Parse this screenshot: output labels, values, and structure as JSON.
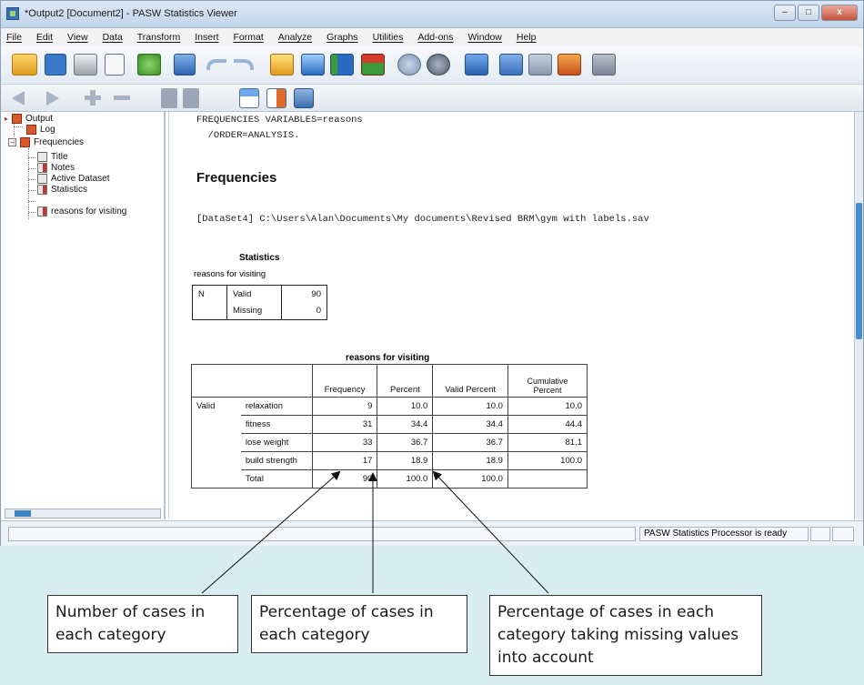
{
  "window": {
    "title": "*Output2 [Document2] - PASW Statistics Viewer",
    "controls": {
      "minimize": "–",
      "maximize": "□",
      "close": "x"
    }
  },
  "menu": {
    "items": [
      "File",
      "Edit",
      "View",
      "Data",
      "Transform",
      "Insert",
      "Format",
      "Analyze",
      "Graphs",
      "Utilities",
      "Add-ons",
      "Window",
      "Help"
    ]
  },
  "toolbar": {
    "row1_icons": [
      "open-folder-icon",
      "save-icon",
      "print-icon",
      "print-preview-icon",
      "export-icon",
      "recall-dialog-icon",
      "undo-icon",
      "redo-icon",
      "goto-case-icon",
      "goto-variable-icon",
      "variables-icon",
      "insert-cases-icon",
      "split-file-icon",
      "weight-cases-icon",
      "select-cases-icon",
      "value-labels-icon",
      "use-sets-icon",
      "show-all-icon",
      "spelling-icon"
    ],
    "row2_icons": [
      "back-icon",
      "forward-icon",
      "expand-icon",
      "collapse-icon",
      "show-icon",
      "hide-icon",
      "insert-heading-icon",
      "insert-title-icon",
      "insert-text-icon"
    ]
  },
  "outline": {
    "items": [
      {
        "label": "Output",
        "level": 0
      },
      {
        "label": "Log",
        "level": 1
      },
      {
        "label": "Frequencies",
        "level": 1
      },
      {
        "label": "Title",
        "level": 2
      },
      {
        "label": "Notes",
        "level": 2
      },
      {
        "label": "Active Dataset",
        "level": 2
      },
      {
        "label": "Statistics",
        "level": 2
      },
      {
        "label": "reasons for visiting",
        "level": 2
      }
    ]
  },
  "output": {
    "syntax_line1": "FREQUENCIES VARIABLES=reasons",
    "syntax_line2": "  /ORDER=ANALYSIS.",
    "heading": "Frequencies",
    "dataset_line": "[DataSet4] C:\\Users\\Alan\\Documents\\My documents\\Revised BRM\\gym with labels.sav",
    "statistics": {
      "title": "Statistics",
      "subtitle": "reasons for visiting",
      "n_label": "N",
      "valid_label": "Valid",
      "valid_value": "90",
      "missing_label": "Missing",
      "missing_value": "0"
    },
    "freq_table": {
      "title": "reasons for visiting",
      "headers": [
        "Frequency",
        "Percent",
        "Valid Percent",
        "Cumulative Percent"
      ],
      "group_label": "Valid",
      "rows": [
        {
          "label": "relaxation",
          "frequency": "9",
          "percent": "10.0",
          "valid_percent": "10.0",
          "cumulative": "10.0"
        },
        {
          "label": "fitness",
          "frequency": "31",
          "percent": "34.4",
          "valid_percent": "34.4",
          "cumulative": "44.4"
        },
        {
          "label": "lose weight",
          "frequency": "33",
          "percent": "36.7",
          "valid_percent": "36.7",
          "cumulative": "81.1"
        },
        {
          "label": "build strength",
          "frequency": "17",
          "percent": "18.9",
          "valid_percent": "18.9",
          "cumulative": "100.0"
        },
        {
          "label": "Total",
          "frequency": "90",
          "percent": "100.0",
          "valid_percent": "100.0",
          "cumulative": ""
        }
      ]
    }
  },
  "status": {
    "processor": "PASW Statistics Processor is ready"
  },
  "callouts": {
    "c1": "Number of cases in each category",
    "c2": "Percentage of cases in each category",
    "c3": "Percentage of cases in each category taking missing values into account"
  },
  "colors": {
    "background": "#d9eef3",
    "scroll_accent": "#4a8bd0"
  }
}
